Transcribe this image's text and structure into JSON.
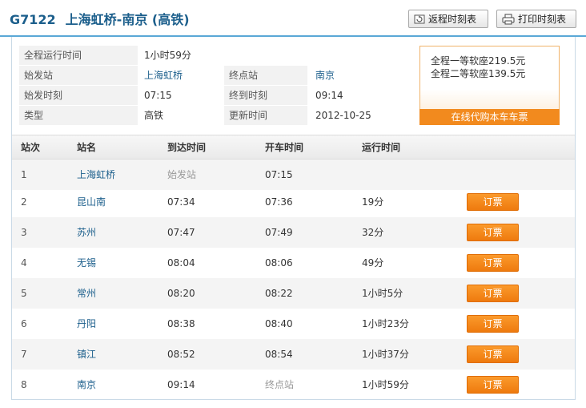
{
  "header": {
    "train_no": "G7122",
    "route": "上海虹桥-南京 (高铁)",
    "return_button": "返程时刻表",
    "print_button": "打印时刻表"
  },
  "info": {
    "total_time_label": "全程运行时间",
    "total_time_value": "1小时59分",
    "start_label": "始发站",
    "start_value": "上海虹桥",
    "end_label": "终点站",
    "end_value": "南京",
    "dep_label": "始发时刻",
    "dep_value": "07:15",
    "arr_label": "终到时刻",
    "arr_value": "09:14",
    "type_label": "类型",
    "type_value": "高铁",
    "update_label": "更新时间",
    "update_value": "2012-10-25"
  },
  "price": {
    "first_class": "全程一等软座219.5元",
    "second_class": "全程二等软座139.5元",
    "buy_label": "在线代购本车车票"
  },
  "table": {
    "headers": [
      "站次",
      "站名",
      "到达时间",
      "开车时间",
      "运行时间"
    ],
    "book_label": "订票",
    "rows": [
      {
        "no": "1",
        "name": "上海虹桥",
        "arrive": "始发站",
        "depart": "07:15",
        "duration": ""
      },
      {
        "no": "2",
        "name": "昆山南",
        "arrive": "07:34",
        "depart": "07:36",
        "duration": "19分"
      },
      {
        "no": "3",
        "name": "苏州",
        "arrive": "07:47",
        "depart": "07:49",
        "duration": "32分"
      },
      {
        "no": "4",
        "name": "无锡",
        "arrive": "08:04",
        "depart": "08:06",
        "duration": "49分"
      },
      {
        "no": "5",
        "name": "常州",
        "arrive": "08:20",
        "depart": "08:22",
        "duration": "1小时5分"
      },
      {
        "no": "6",
        "name": "丹阳",
        "arrive": "08:38",
        "depart": "08:40",
        "duration": "1小时23分"
      },
      {
        "no": "7",
        "name": "镇江",
        "arrive": "08:52",
        "depart": "08:54",
        "duration": "1小时37分"
      },
      {
        "no": "8",
        "name": "南京",
        "arrive": "09:14",
        "depart": "终点站",
        "duration": "1小时59分"
      }
    ]
  },
  "colors": {
    "accent": "#1c5f8c",
    "header_border": "#5aa8d6",
    "book_orange": "#f28a1e"
  },
  "icons": {
    "return": "refresh-icon",
    "print": "printer-icon"
  }
}
